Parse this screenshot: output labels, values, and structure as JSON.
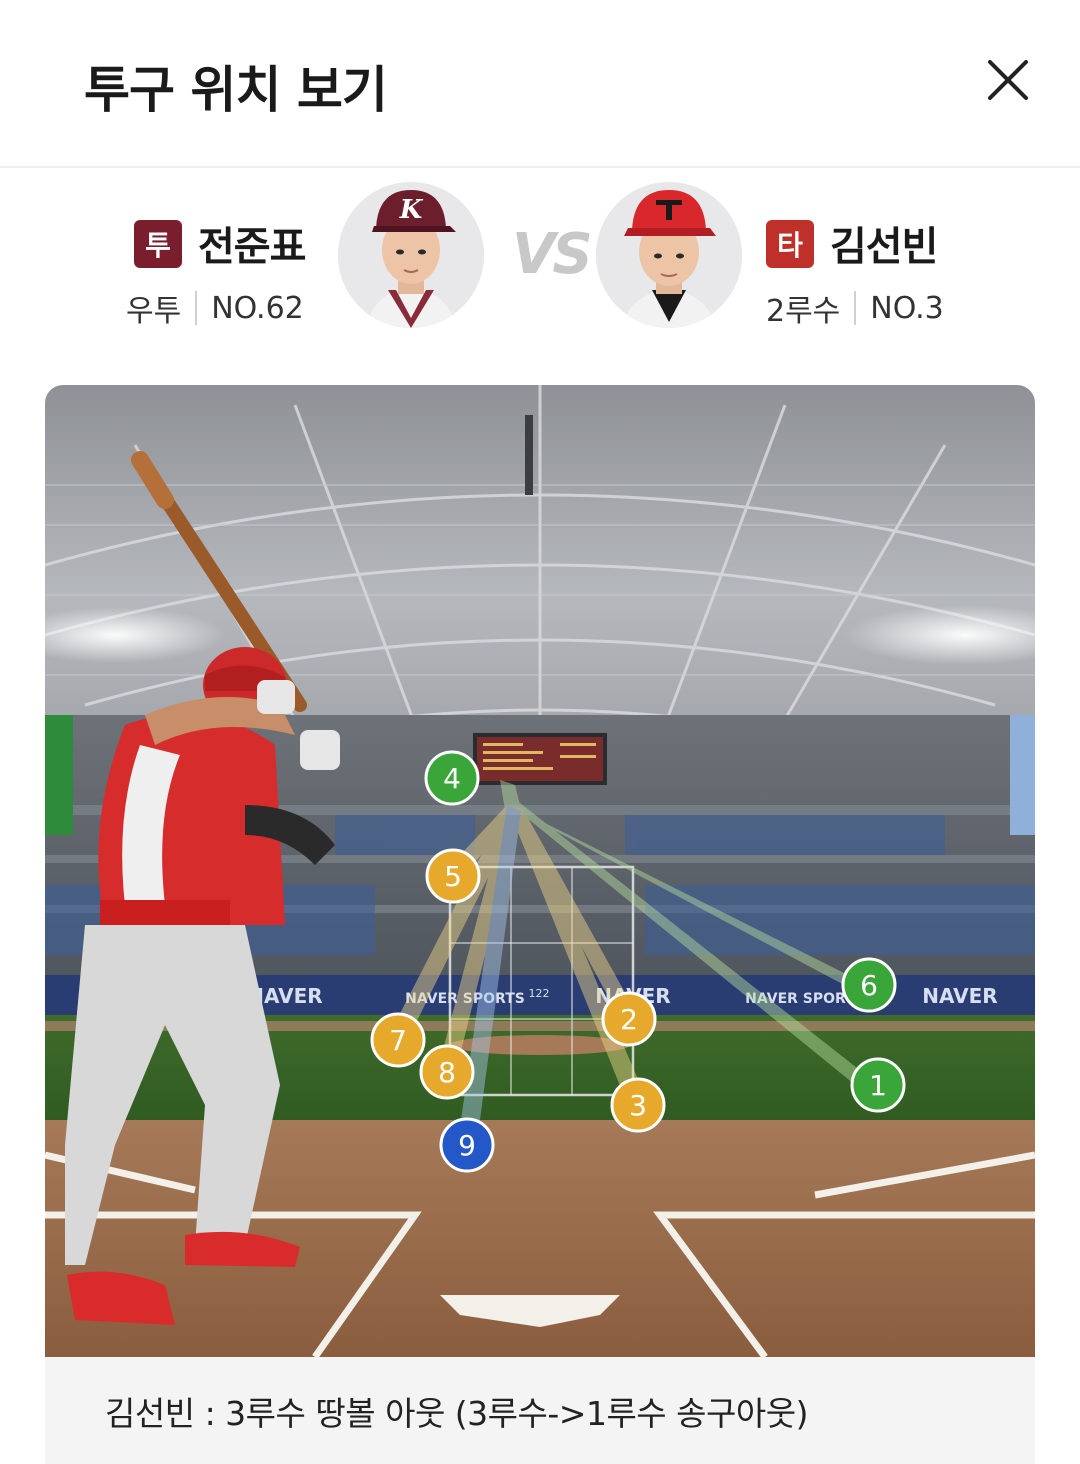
{
  "header": {
    "title": "투구 위치 보기"
  },
  "pitcher": {
    "role_badge": "투",
    "name": "전준표",
    "position": "우투",
    "number": "NO.62",
    "badge_color": "#7a1e2e"
  },
  "vs_label": "VS",
  "batter": {
    "role_badge": "타",
    "name": "김선빈",
    "position": "2루수",
    "number": "NO.3",
    "badge_color": "#c0302a"
  },
  "field": {
    "banners": [
      "NAVER",
      "NAVER SPORTS",
      "122",
      "NAVER",
      "NAVER SPORTS",
      "NAVER"
    ],
    "pitches": [
      {
        "number": "1",
        "color": "green"
      },
      {
        "number": "2",
        "color": "yellow"
      },
      {
        "number": "3",
        "color": "yellow"
      },
      {
        "number": "4",
        "color": "green"
      },
      {
        "number": "5",
        "color": "yellow"
      },
      {
        "number": "6",
        "color": "green"
      },
      {
        "number": "7",
        "color": "yellow"
      },
      {
        "number": "8",
        "color": "yellow"
      },
      {
        "number": "9",
        "color": "blue"
      }
    ],
    "colors": {
      "green": "#3aa63a",
      "yellow": "#e6a92c",
      "blue": "#2457c8"
    }
  },
  "result": {
    "text": "김선빈 : 3루수 땅볼 아웃 (3루수->1루수 송구아웃)"
  }
}
